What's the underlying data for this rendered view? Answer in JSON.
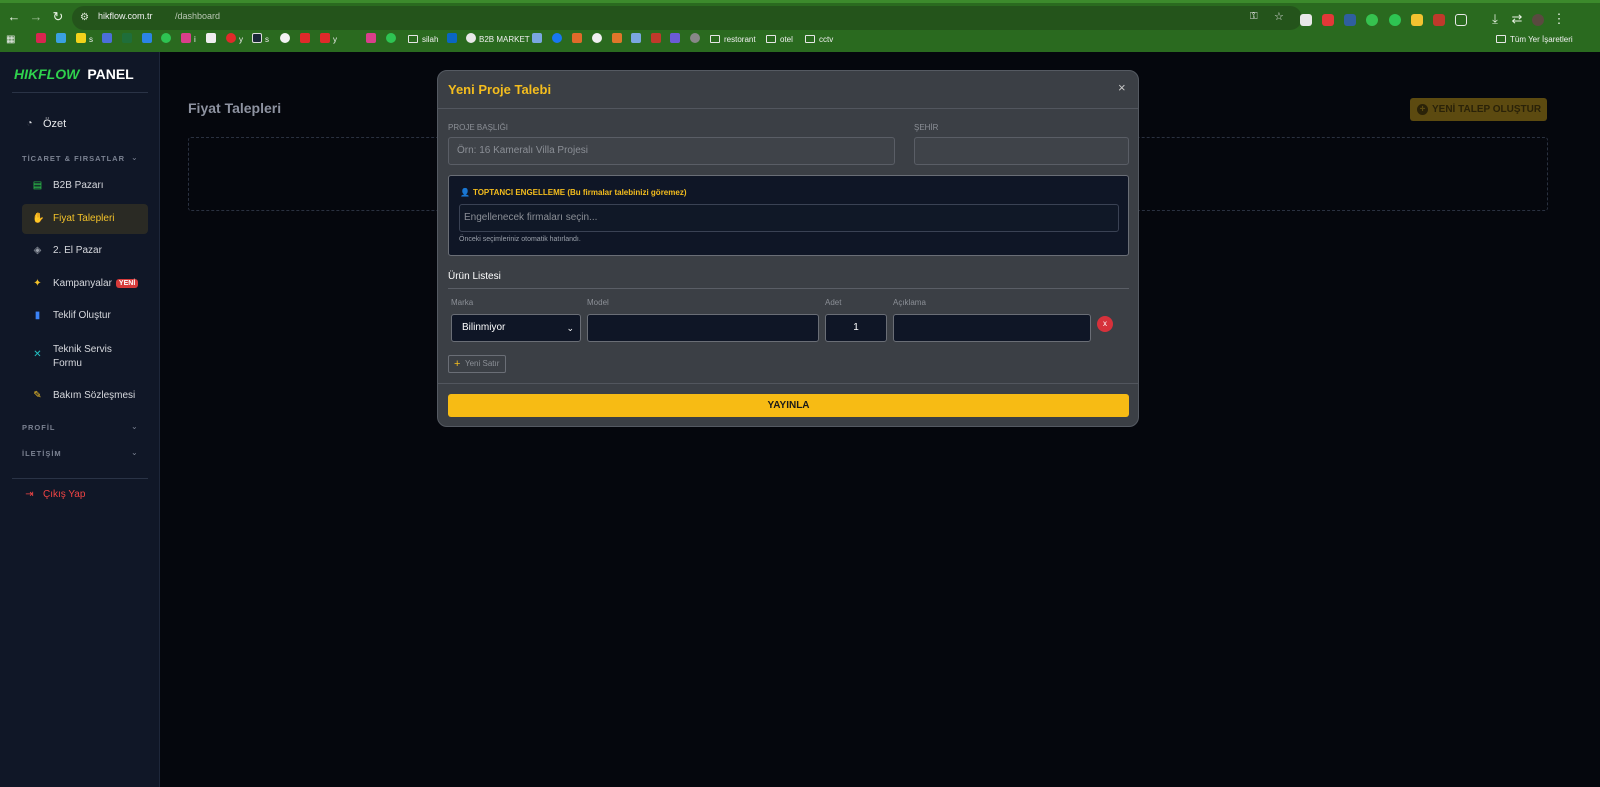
{
  "browser": {
    "url_host": "hikflow.com.tr",
    "url_path": "/dashboard",
    "bookmarks": [
      {
        "label": "",
        "color": "#d9254f"
      },
      {
        "label": "",
        "color": "#3aa0e0"
      },
      {
        "label": "s",
        "color": "#f2d21b"
      },
      {
        "label": "",
        "color": "#4b6fd8"
      },
      {
        "label": "",
        "color": "#1f6e3a"
      },
      {
        "label": "",
        "color": "#2b84e5"
      },
      {
        "label": "",
        "color": "#2ec452"
      },
      {
        "label": "i",
        "color": "#d93f8a"
      },
      {
        "label": "",
        "color": "#eeeeee"
      },
      {
        "label": "y",
        "color": "#e02a2a"
      },
      {
        "label": "s",
        "color": "#1b2838"
      },
      {
        "label": "",
        "color": "#f3f3f3"
      },
      {
        "label": "",
        "color": "#e02a2a"
      },
      {
        "label": "y",
        "color": "#e02a2a"
      },
      {
        "label": "",
        "color": "#d93f8a"
      },
      {
        "label": "",
        "color": "#2ec452"
      }
    ],
    "bookmarks_named": [
      "silah",
      "B2B MARKET",
      "restorant",
      "otel",
      "cctv"
    ],
    "all_bookmarks": "Tüm Yer İşaretleri"
  },
  "sidebar": {
    "logo_hik": "HIKFLOW",
    "logo_panel": "PANEL",
    "summary": "Özet",
    "section_trade": "TİCARET & FIRSATLAR",
    "items": [
      {
        "label": "B2B Pazarı",
        "icon": "store-icon",
        "color": "#2fd24d"
      },
      {
        "label": "Fiyat Talepleri",
        "icon": "hand-coin-icon",
        "color": "#f3c22a"
      },
      {
        "label": "2. El Pazar",
        "icon": "tag-icon",
        "color": "#9aa0aa"
      },
      {
        "label": "Kampanyalar",
        "icon": "handshake-icon",
        "color": "#f3c22a",
        "badge": "YENİ"
      },
      {
        "label": "Teklif Oluştur",
        "icon": "file-icon",
        "color": "#3b82f6"
      },
      {
        "label": "Teknik Servis",
        "label2": "Formu",
        "icon": "tools-icon",
        "color": "#22c1c3"
      },
      {
        "label": "Bakım Sözleşmesi",
        "icon": "contract-icon",
        "color": "#f3c22a"
      }
    ],
    "section_profile": "PROFİL",
    "section_contact": "İLETİŞİM",
    "logout": "Çıkış Yap"
  },
  "main": {
    "title": "Fiyat Talepleri",
    "new_request": "YENİ TALEP OLUŞTUR"
  },
  "modal": {
    "title": "Yeni Proje Talebi",
    "close": "×",
    "project_title_label": "PROJE BAŞLIĞI",
    "project_title_placeholder": "Örn: 16 Kameralı Villa Projesi",
    "city_label": "ŞEHİR",
    "city_value": "",
    "block_title": "TOPTANCI ENGELLEME (Bu firmalar talebinizi göremez)",
    "block_placeholder": "Engellenecek firmaları seçin...",
    "block_hint": "Önceki seçimleriniz otomatik hatırlandı.",
    "product_list": "Ürün Listesi",
    "columns": [
      "Marka",
      "Model",
      "Adet",
      "Açıklama"
    ],
    "row": {
      "brand": "Bilinmiyor",
      "model": "",
      "qty": "1",
      "desc": ""
    },
    "remove": "x",
    "add_row": "Yeni Satır",
    "publish": "YAYINLA"
  }
}
